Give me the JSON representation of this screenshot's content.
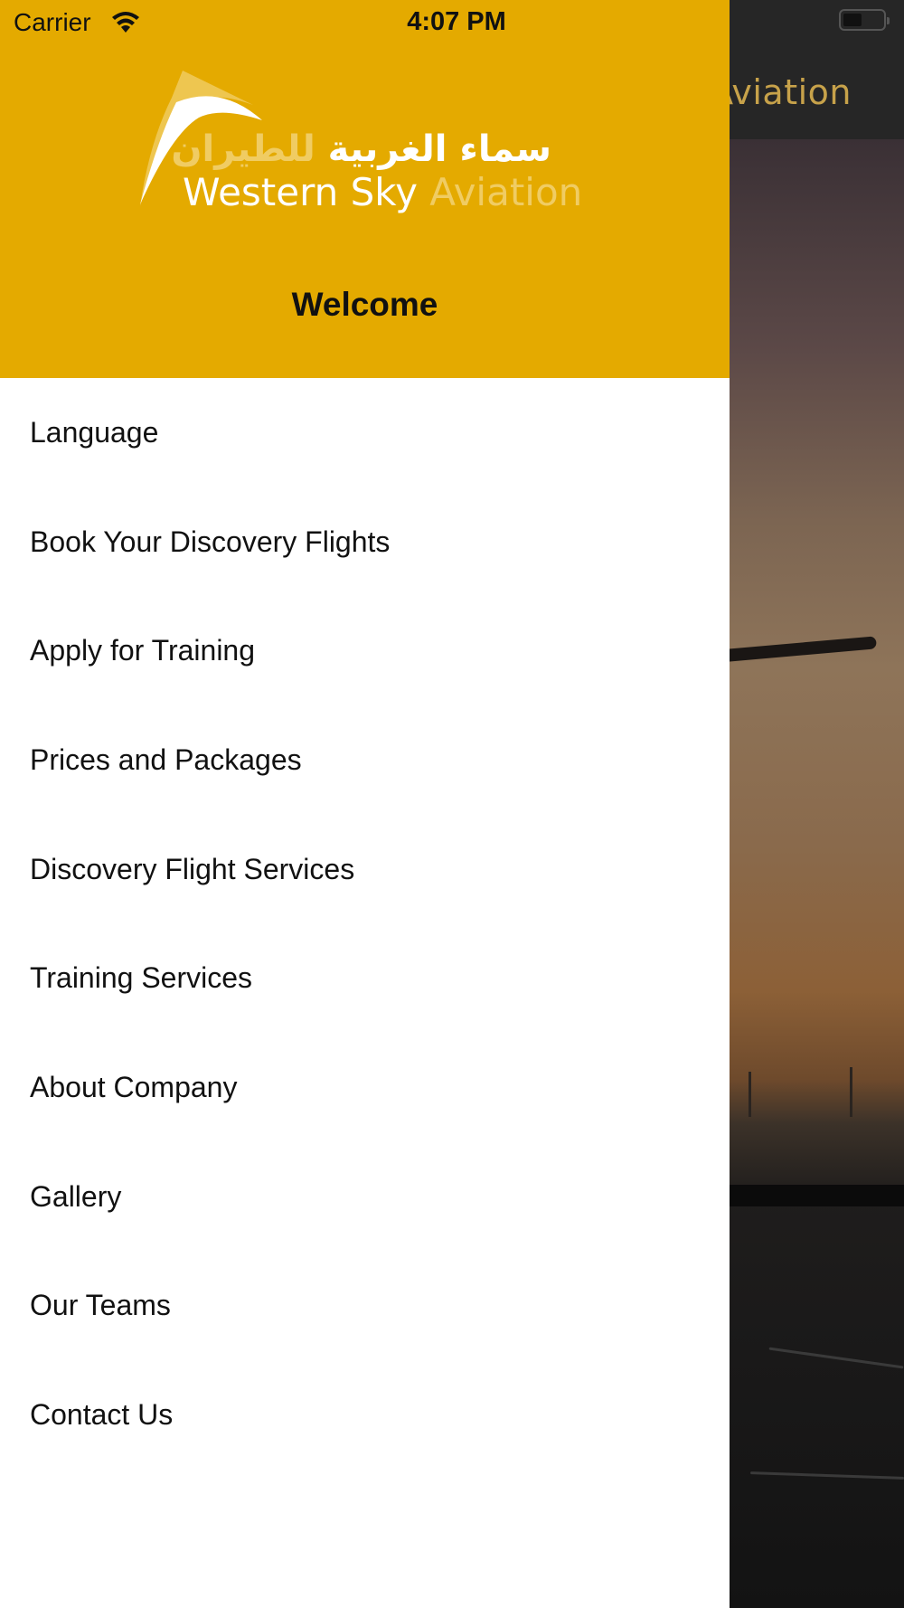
{
  "status_bar": {
    "carrier": "Carrier",
    "time": "4:07 PM"
  },
  "background_app": {
    "title_fragment": "y Aviation"
  },
  "drawer": {
    "logo": {
      "arabic_bright": "سماء الغربية",
      "arabic_faint": "للطيران",
      "latin_bright": "Western Sky",
      "latin_faint": "Aviation"
    },
    "welcome": "Welcome",
    "menu": [
      {
        "label": "Language"
      },
      {
        "label": "Book Your Discovery Flights"
      },
      {
        "label": "Apply for Training"
      },
      {
        "label": "Prices and Packages"
      },
      {
        "label": "Discovery Flight Services"
      },
      {
        "label": "Training Services"
      },
      {
        "label": "About Company"
      },
      {
        "label": "Gallery"
      },
      {
        "label": "Our Teams"
      },
      {
        "label": "Contact Us"
      }
    ]
  },
  "colors": {
    "header": "#e4aa00",
    "accent_text": "#c7a24a"
  },
  "icons": [
    "wifi-icon",
    "battery-icon",
    "logo-swoosh-icon"
  ]
}
